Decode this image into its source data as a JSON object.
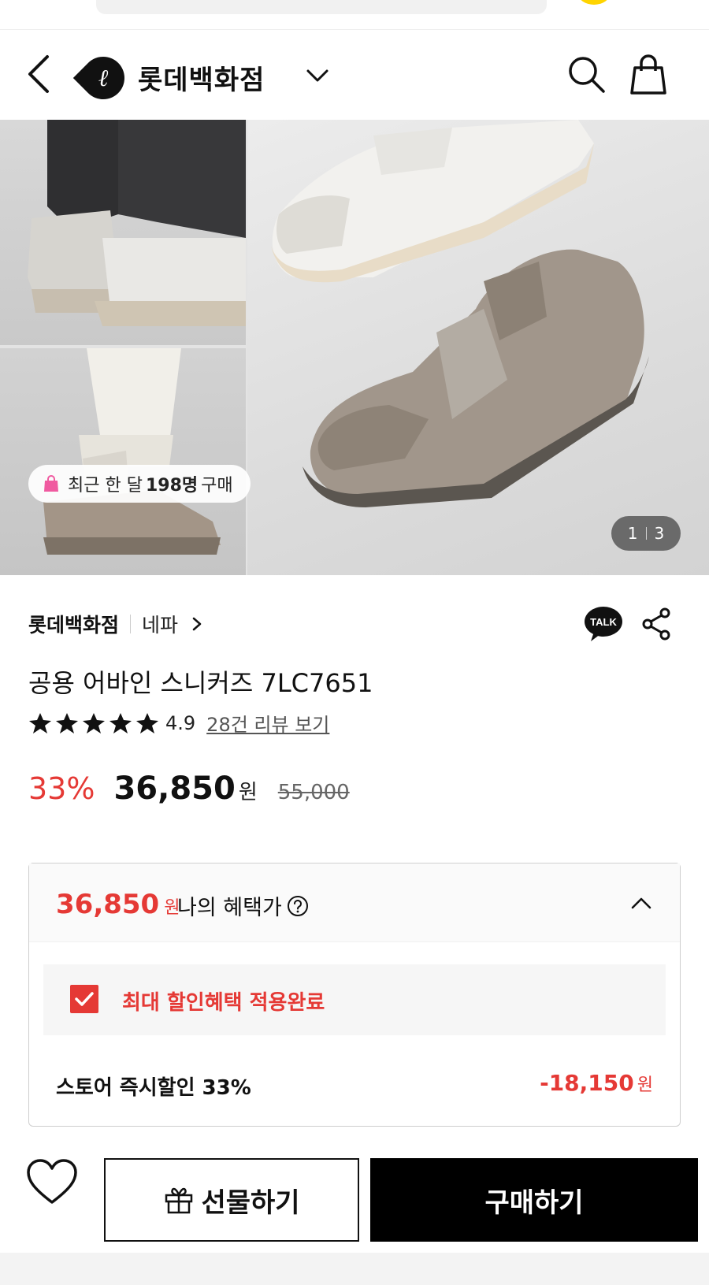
{
  "header": {
    "brand_name": "롯데백화점",
    "brand_mark": "ℓ"
  },
  "hero": {
    "badge_prefix": "최근 한 달",
    "badge_count": "198명",
    "badge_suffix": "구매",
    "pager_current": "1",
    "pager_total": "3"
  },
  "product": {
    "store": "롯데백화점",
    "brand": "네파",
    "talk_label": "TALK",
    "title": "공용 어바인 스니커즈 7LC7651",
    "rating": "4.9",
    "review_link": "28건 리뷰 보기",
    "discount_rate": "33%",
    "price": "36,850",
    "currency": "원",
    "original_price": "55,000"
  },
  "benefit": {
    "price": "36,850",
    "currency": "원",
    "label": "나의 혜택가",
    "applied_text": "최대 할인혜택 적용완료",
    "discount_label": "스토어 즉시할인 33%",
    "discount_value": "-18,150",
    "discount_currency": "원"
  },
  "actions": {
    "gift_label": "선물하기",
    "buy_label": "구매하기"
  },
  "colors": {
    "accent_red": "#e53935",
    "primary_black": "#000000"
  }
}
